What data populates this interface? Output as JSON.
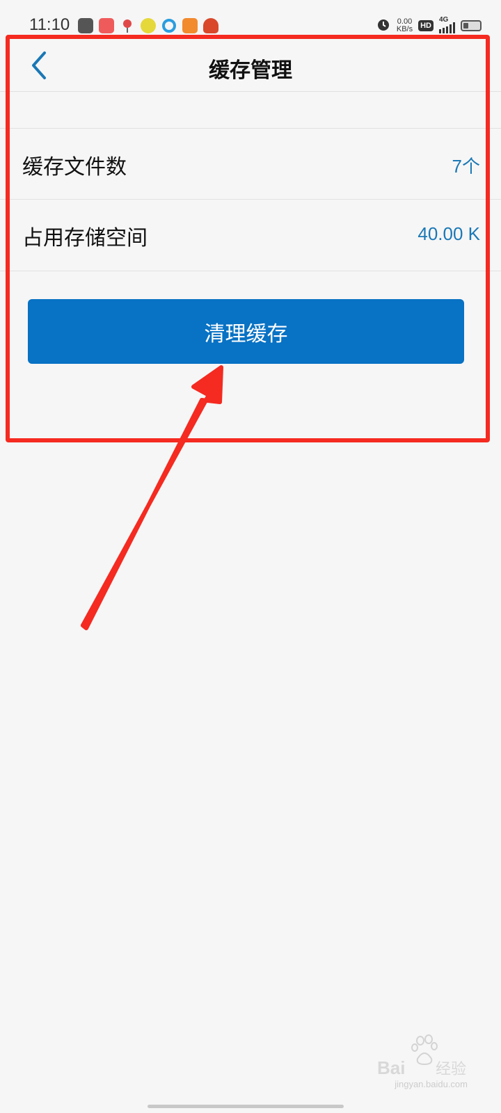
{
  "status_bar": {
    "time": "11:10",
    "net_speed_value": "0.00",
    "net_speed_unit": "KB/s",
    "hd_label": "HD",
    "network_label": "4G",
    "battery_level": 0.3
  },
  "nav": {
    "title": "缓存管理",
    "back_icon": "chevron-left-icon"
  },
  "rows": [
    {
      "label": "缓存文件数",
      "value": "7个"
    },
    {
      "label": "占用存储空间",
      "value": "40.00 K"
    }
  ],
  "clear_button": {
    "label": "清理缓存"
  },
  "watermark": {
    "text": "jingyan.baidu.com"
  },
  "colors": {
    "accent": "#0872c4",
    "value_text": "#1a78b6",
    "annotation": "#f52a20",
    "background": "#f6f6f6"
  }
}
